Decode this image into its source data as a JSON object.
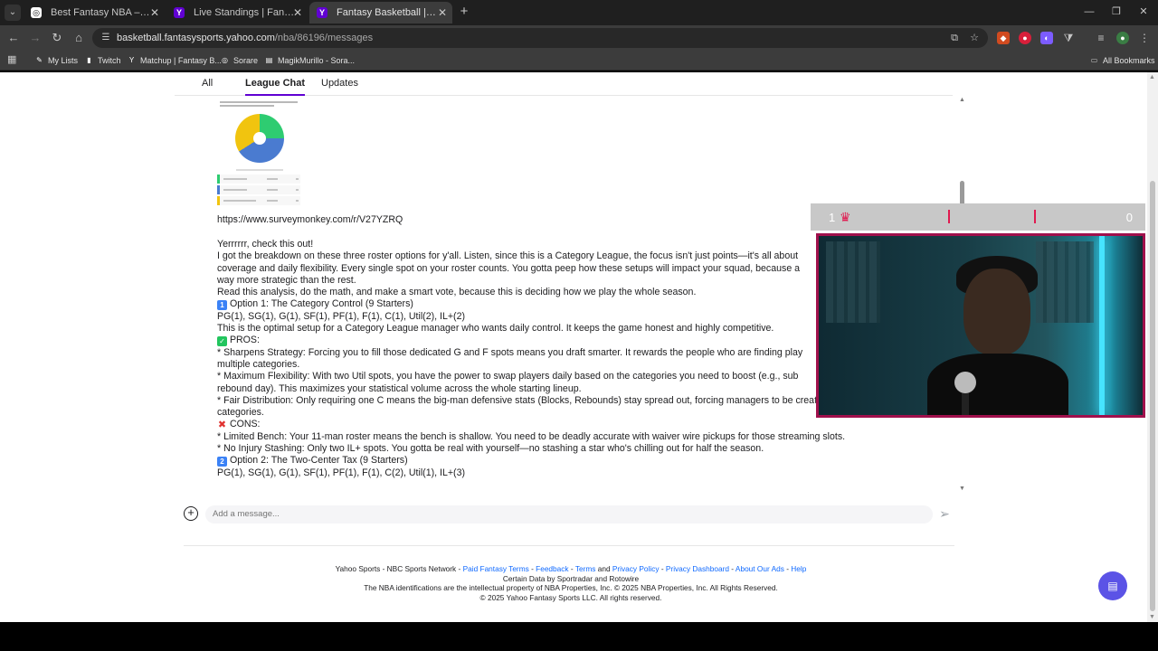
{
  "browser": {
    "tabs": [
      {
        "label": "Best Fantasy NBA – Sorare NBA",
        "icon": "sorare-icon",
        "active": false
      },
      {
        "label": "Live Standings | Fantasy Basketball",
        "icon": "yahoo-icon",
        "active": false
      },
      {
        "label": "Fantasy Basketball | Yahoo! Sports",
        "icon": "yahoo-icon",
        "active": true
      }
    ],
    "url_host": "basketball.fantasysports.yahoo.com",
    "url_path": "/nba/86196/messages",
    "bookmarks": [
      {
        "label": "My Lists",
        "icon": "my-lists-icon",
        "color": "#6aa3ff"
      },
      {
        "label": "Twitch",
        "icon": "twitch-icon",
        "color": "#9146ff"
      },
      {
        "label": "Matchup | Fantasy B...",
        "icon": "yahoo-icon",
        "color": "#6001d2"
      },
      {
        "label": "Sorare",
        "icon": "sorare-icon",
        "color": "#555555"
      },
      {
        "label": "MagikMurillo - Sora...",
        "icon": "sheets-icon",
        "color": "#1e8e3e"
      }
    ],
    "all_bookmarks": "All Bookmarks"
  },
  "chat": {
    "tabs": [
      "All",
      "League Chat",
      "Updates"
    ],
    "active_tab": "League Chat",
    "poll_colors": {
      "green": "#2ecc71",
      "blue": "#4a7bd0",
      "yellow": "#f1c40f"
    },
    "link": "https://www.surveymonkey.com/r/V27YZRQ",
    "lines": [
      "Yerrrrrr, check this out!",
      "I got the breakdown on these three roster options for y'all. Listen, since this is a Category League, the focus isn't just points—it's all about",
      "coverage and daily flexibility. Every single spot on your roster counts. You gotta peep how these setups will impact your squad, because a",
      "way more strategic than the rest.",
      "Read this analysis, do the math, and make a smart vote, because this is deciding how we play the whole season.",
      "Option 1: The Category Control (9 Starters)",
      "PG(1), SG(1), G(1), SF(1), PF(1), F(1), C(1), Util(2), IL+(2)",
      "This is the optimal setup for a Category League manager who wants daily control. It keeps the game honest and highly competitive.",
      "PROS:",
      "* Sharpens Strategy: Forcing you to fill those dedicated G and F spots means you draft smarter. It rewards the people who are finding play",
      "multiple categories.",
      "* Maximum Flexibility: With two Util spots, you have the power to swap players daily based on the categories you need to boost (e.g., sub",
      "rebound day). This maximizes your statistical volume across the whole starting lineup.",
      "* Fair Distribution: Only requiring one C means the big-man defensive stats (Blocks, Rebounds) stay spread out, forcing managers to be creative in winning those",
      "categories.",
      "CONS:",
      "* Limited Bench: Your 11-man roster means the bench is shallow. You need to be deadly accurate with waiver wire pickups for those streaming slots.",
      "* No Injury Stashing: Only two IL+ spots. You gotta be real with yourself—no stashing a star who's chilling out for half the season.",
      "Option 2: The Two-Center Tax (9 Starters)",
      "PG(1), SG(1), G(1), SF(1), PF(1), F(1), C(2), Util(1), IL+(3)"
    ],
    "composer_placeholder": "Add a message..."
  },
  "footer": {
    "line1_prefix": "Yahoo Sports - NBC Sports Network - ",
    "links": [
      "Paid Fantasy Terms",
      "Feedback",
      "Terms",
      "Privacy Policy",
      "Privacy Dashboard",
      "About Our Ads",
      "Help"
    ],
    "and": "and",
    "line2": "Certain Data by Sportradar and Rotowire",
    "line3": "The NBA identifications are the intellectual property of NBA Properties, Inc. © 2025 NBA Properties, Inc. All Rights Reserved.",
    "line4": "© 2025 Yahoo Fantasy Sports LLC. All rights reserved."
  },
  "stream_overlay": {
    "left_score": "1",
    "right_score": "0",
    "accent": "#e0194f",
    "frame_color": "#a0104c"
  }
}
